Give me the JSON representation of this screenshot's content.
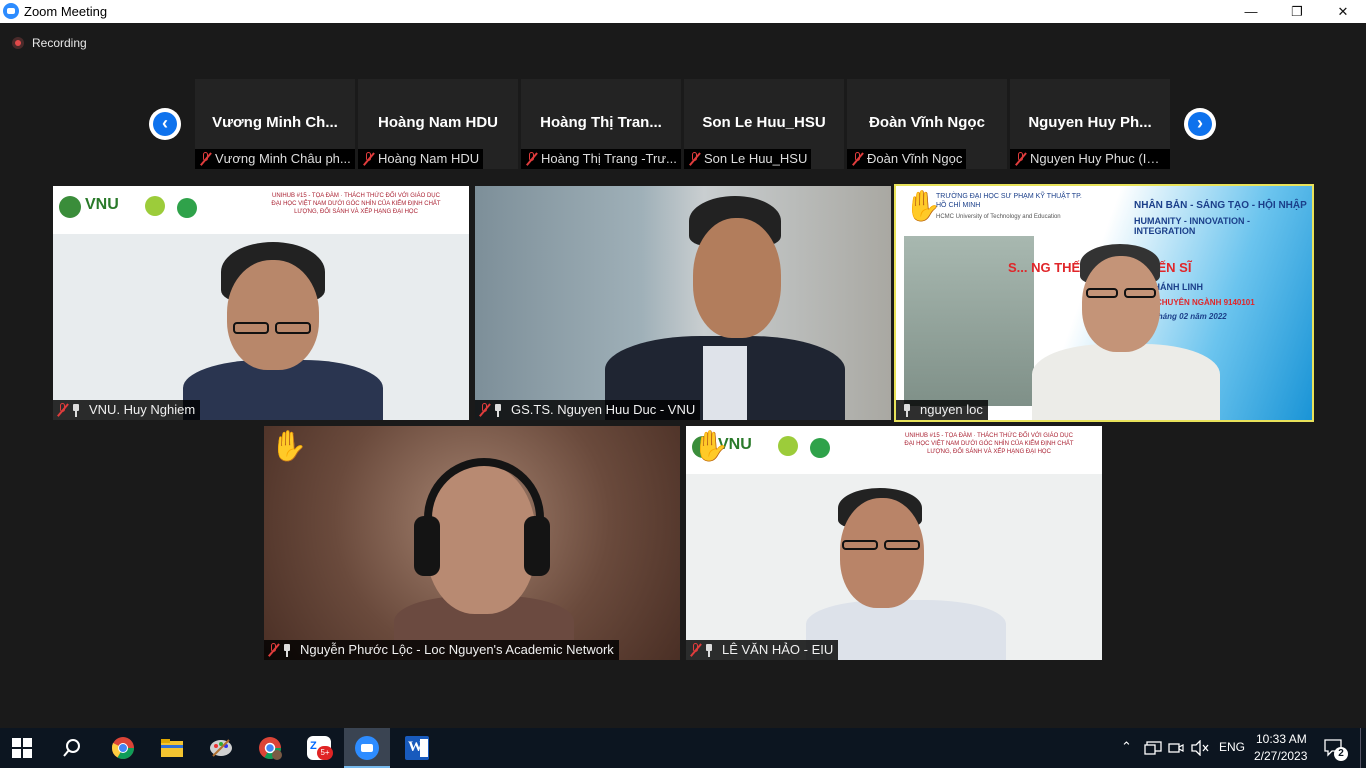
{
  "window": {
    "title": "Zoom Meeting",
    "controls": {
      "minimize": "—",
      "restore": "❐",
      "close": "✕"
    }
  },
  "recording": {
    "label": "Recording"
  },
  "strip": {
    "prev_glyph": "‹",
    "next_glyph": "›",
    "participants": [
      {
        "name": "Vương  Minh  Ch...",
        "label": "Vương Minh Châu ph..."
      },
      {
        "name": "Hoàng Nam HDU",
        "label": "Hoàng Nam HDU"
      },
      {
        "name": "Hoàng  Thị  Tran...",
        "label": "Hoàng Thị Trang -Trư..."
      },
      {
        "name": "Son Le Huu_HSU",
        "label": "Son Le Huu_HSU"
      },
      {
        "name": "Đoàn Vĩnh Ngọc",
        "label": "Đoàn Vĩnh Ngọc"
      },
      {
        "name": "Nguyen  Huy  Ph...",
        "label": "Nguyen Huy Phuc (IU..."
      }
    ]
  },
  "tiles": [
    {
      "label": "VNU. Huy Nghiem",
      "mic_muted": true,
      "hand_raised": false,
      "active": false,
      "banner": {
        "logo": "VNU",
        "text": "UNIHUB #15 - TỌA ĐÀM · THÁCH THỨC ĐỐI VỚI GIÁO DỤC ĐẠI HỌC VIỆT NAM DƯỚI GÓC NHÌN CỦA KIỂM ĐỊNH CHẤT LƯỢNG, ĐỐI SÁNH VÀ XẾP HẠNG ĐẠI HỌC"
      }
    },
    {
      "label": "GS.TS. Nguyen Huu Duc - VNU",
      "mic_muted": true,
      "hand_raised": false,
      "active": false
    },
    {
      "label": "nguyen loc",
      "mic_muted": false,
      "hand_raised": true,
      "active": true,
      "slide": {
        "school": "TRƯỜNG ĐẠI HỌC SƯ PHẠM KỸ THUẬT TP. HỒ CHÍ MINH",
        "school_en": "HCMC University of Technology and Education",
        "motto_vi": "NHÂN BẢN - SÁNG TẠO - HỘI NHẬP",
        "motto_en": "HUMANITY - INNOVATION - INTEGRATION",
        "line1": "S... NG THẾ LUẬN ÁN TIẾN SĨ",
        "line2": "...RS. LƯU KHÁNH LINH",
        "line3": "...C HỌC – MÃ CHUYÊN NGÀNH 9140101",
        "line4": "...inh, ngày 26 tháng 02 năm 2022"
      }
    },
    {
      "label": "Nguyễn Phước Lộc - Loc Nguyen's Academic Network",
      "mic_muted": true,
      "hand_raised": true,
      "active": false
    },
    {
      "label": "LÊ VĂN HẢO - EIU",
      "mic_muted": true,
      "hand_raised": true,
      "active": false,
      "banner": {
        "logo": "VNU",
        "text": "UNIHUB #15 - TỌA ĐÀM · THÁCH THỨC ĐỐI VỚI GIÁO DỤC ĐẠI HỌC VIỆT NAM DƯỚI GÓC NHÌN CỦA KIỂM ĐỊNH CHẤT LƯỢNG, ĐỐI SÁNH VÀ XẾP HẠNG ĐẠI HỌC"
      }
    }
  ],
  "taskbar": {
    "apps": [
      "start-icon",
      "search-icon",
      "chrome-icon",
      "file-explorer-icon",
      "paint-icon",
      "chrome-profile-icon",
      "zalo-icon",
      "zoom-icon",
      "word-icon"
    ],
    "zalo_badge": "5+",
    "language": "ENG",
    "time": "10:33 AM",
    "date": "2/27/2023",
    "notification_count": "2"
  },
  "colors": {
    "accent": "#0e72ed",
    "active_speaker": "#e8e25a",
    "muted": "#e03c3c",
    "taskbar": "#0c1520"
  }
}
